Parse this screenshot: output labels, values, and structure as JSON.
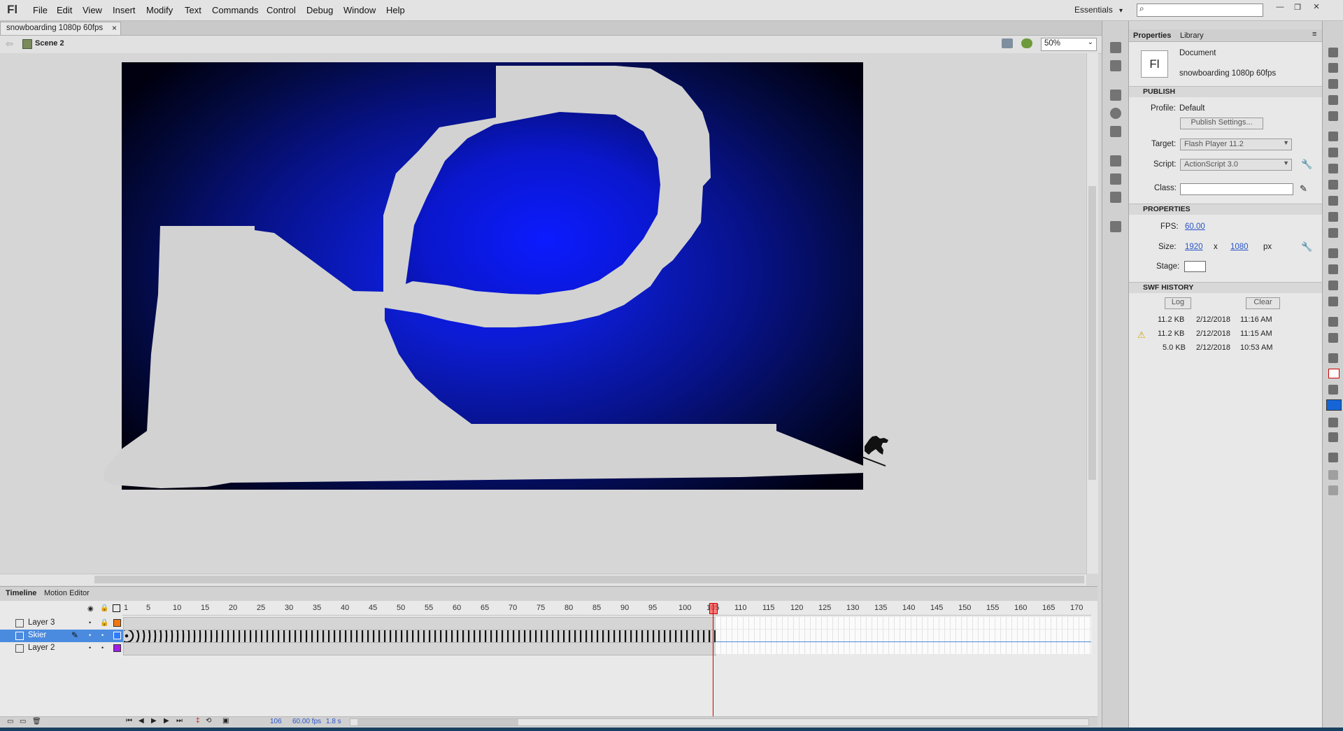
{
  "app": {
    "logo": "Fl"
  },
  "menu": [
    "File",
    "Edit",
    "View",
    "Insert",
    "Modify",
    "Text",
    "Commands",
    "Control",
    "Debug",
    "Window",
    "Help"
  ],
  "workspace": {
    "label": "Essentials",
    "caret": "▾"
  },
  "search": {
    "icon": "⌕"
  },
  "document": {
    "tab_title": "snowboarding 1080p 60fps",
    "close": "×",
    "scene": "Scene 2",
    "zoom": "50%"
  },
  "timeline": {
    "tabs": [
      "Timeline",
      "Motion Editor"
    ],
    "ticks": [
      "1",
      "5",
      "10",
      "15",
      "20",
      "25",
      "30",
      "35",
      "40",
      "45",
      "50",
      "55",
      "60",
      "65",
      "70",
      "75",
      "80",
      "85",
      "90",
      "95",
      "100",
      "105",
      "110",
      "115",
      "120",
      "125",
      "130",
      "135",
      "140",
      "145",
      "150",
      "155",
      "160",
      "165",
      "170"
    ],
    "layers": [
      {
        "name": "Layer 3",
        "color": "#f07a10",
        "selected": false
      },
      {
        "name": "Skier",
        "color": "#2f7bff",
        "selected": true
      },
      {
        "name": "Layer 2",
        "color": "#a020e0",
        "selected": false
      }
    ],
    "current_frame": "106",
    "fps": "60.00 fps",
    "time": "1.8 s"
  },
  "properties": {
    "tabs": [
      "Properties",
      "Library"
    ],
    "doc_type": "Document",
    "doc_name": "snowboarding 1080p 60fps",
    "doc_icon": "Fl",
    "publish": {
      "section": "PUBLISH",
      "profile_label": "Profile:",
      "profile_value": "Default",
      "settings_button": "Publish Settings...",
      "target_label": "Target:",
      "target_value": "Flash Player 11.2",
      "script_label": "Script:",
      "script_value": "ActionScript 3.0",
      "class_label": "Class:"
    },
    "props": {
      "section": "PROPERTIES",
      "fps_label": "FPS:",
      "fps_value": "60.00",
      "size_label": "Size:",
      "width": "1920",
      "x": "x",
      "height": "1080",
      "unit": "px",
      "stage_label": "Stage:"
    },
    "history": {
      "section": "SWF HISTORY",
      "log_button": "Log",
      "clear_button": "Clear",
      "entries": [
        {
          "size": "11.2 KB",
          "date": "2/12/2018",
          "time": "11:16 AM",
          "warn": false
        },
        {
          "size": "11.2 KB",
          "date": "2/12/2018",
          "time": "11:15 AM",
          "warn": true
        },
        {
          "size": "5.0 KB",
          "date": "2/12/2018",
          "time": "10:53 AM",
          "warn": false
        }
      ]
    }
  }
}
